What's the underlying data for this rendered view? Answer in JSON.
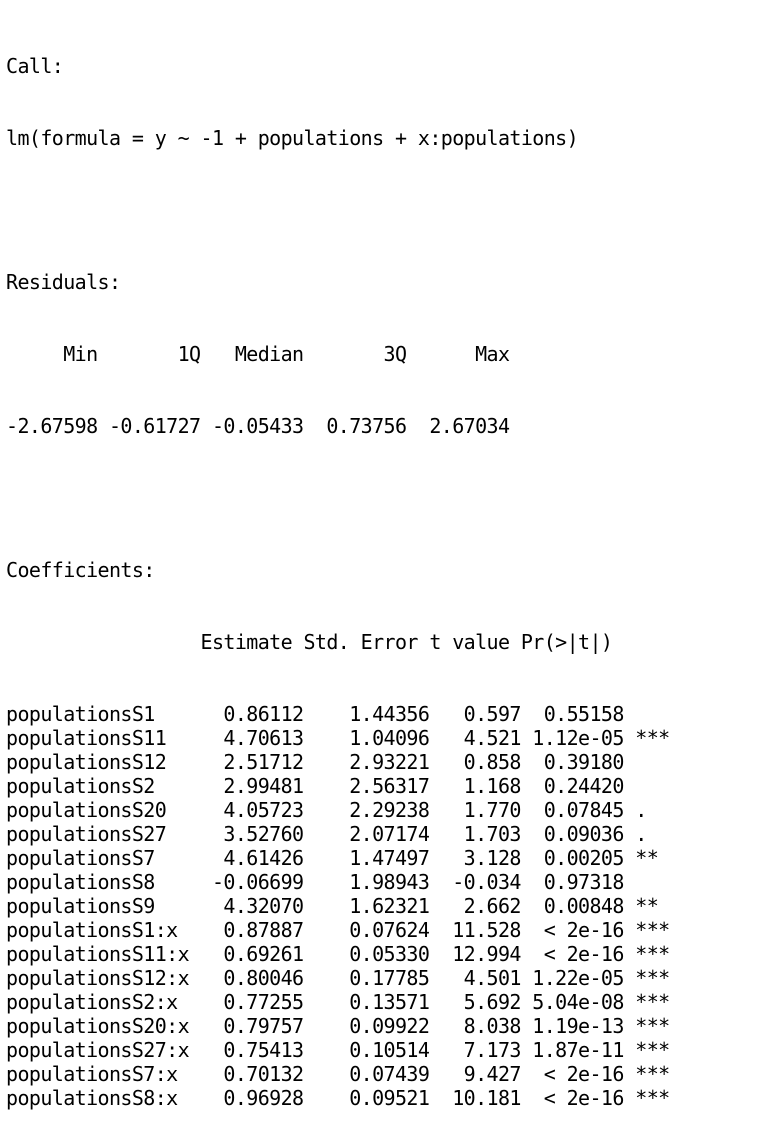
{
  "call": {
    "header": "Call:",
    "formula": "lm(formula = y ~ -1 + populations + x:populations)"
  },
  "residuals": {
    "header": "Residuals:",
    "columns": "     Min       1Q   Median       3Q      Max ",
    "values": "-2.67598 -0.61727 -0.05433  0.73756  2.67034 "
  },
  "coefficients": {
    "header": "Coefficients:",
    "columns": "                 Estimate Std. Error t value Pr(>|t|)    ",
    "rows": [
      "populationsS1      0.86112    1.44356   0.597  0.55158    ",
      "populationsS11     4.70613    1.04096   4.521 1.12e-05 ***",
      "populationsS12     2.51712    2.93221   0.858  0.39180    ",
      "populationsS2      2.99481    2.56317   1.168  0.24420    ",
      "populationsS20     4.05723    2.29238   1.770  0.07845 .  ",
      "populationsS27     3.52760    2.07174   1.703  0.09036 .  ",
      "populationsS7      4.61426    1.47497   3.128  0.00205 ** ",
      "populationsS8     -0.06699    1.98943  -0.034  0.97318    ",
      "populationsS9      4.32070    1.62321   2.662  0.00848 ** ",
      "populationsS1:x    0.87887    0.07624  11.528  < 2e-16 ***",
      "populationsS11:x   0.69261    0.05330  12.994  < 2e-16 ***",
      "populationsS12:x   0.80046    0.17785   4.501 1.22e-05 ***",
      "populationsS2:x    0.77255    0.13571   5.692 5.04e-08 ***",
      "populationsS20:x   0.79757    0.09922   8.038 1.19e-13 ***",
      "populationsS27:x   0.75413    0.10514   7.173 1.87e-11 ***",
      "populationsS7:x    0.70132    0.07439   9.427  < 2e-16 ***",
      "populationsS8:x    0.96928    0.09521  10.181  < 2e-16 ***"
    ]
  }
}
